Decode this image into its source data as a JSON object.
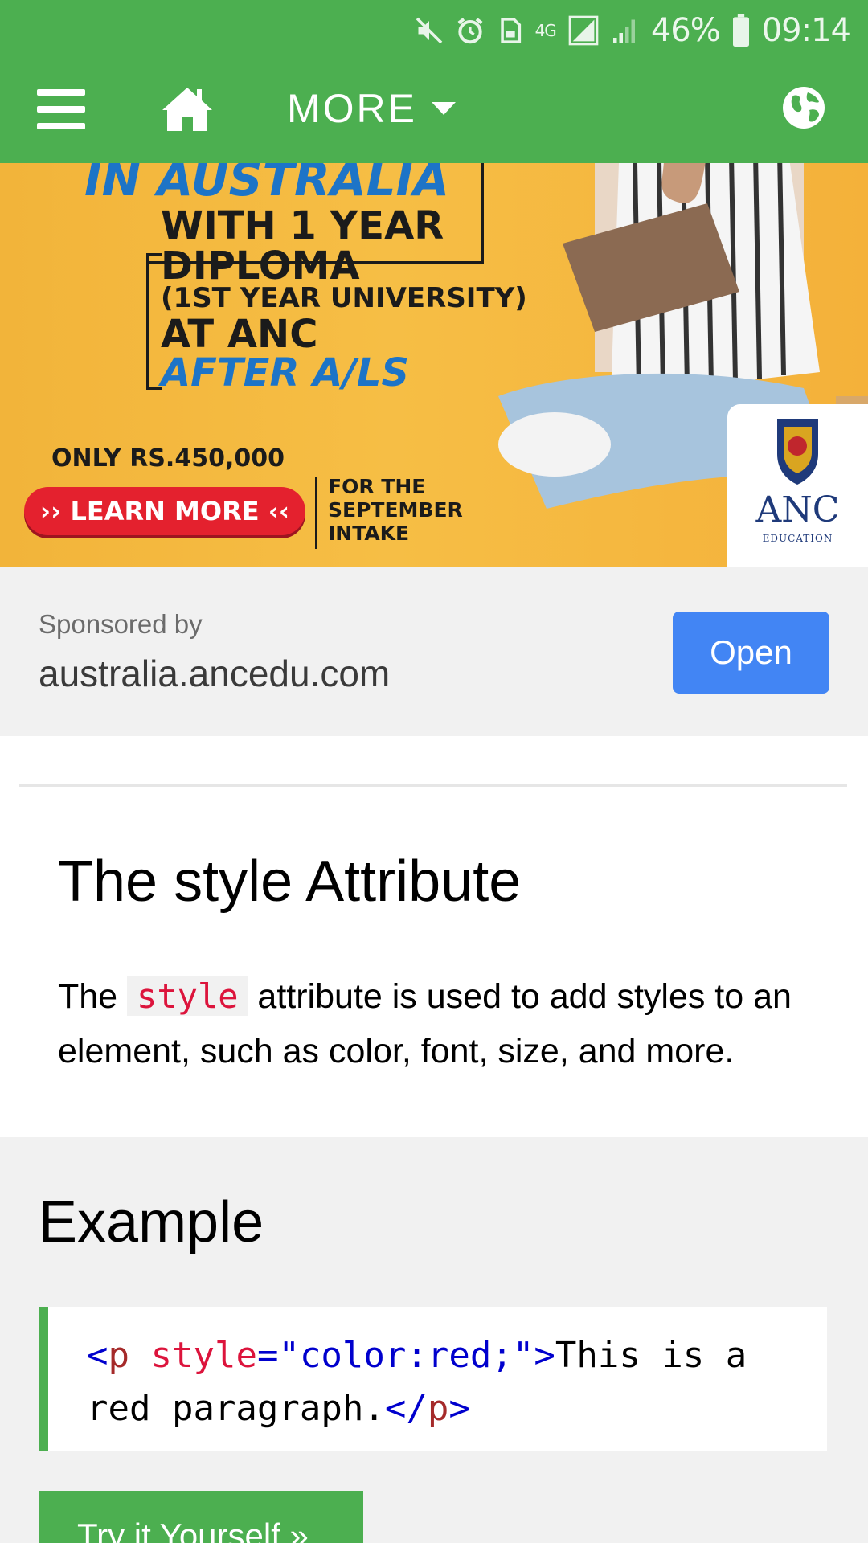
{
  "status_bar": {
    "battery_percent": "46%",
    "time": "09:14",
    "network": "4G",
    "icons": [
      "mute-icon",
      "alarm-icon",
      "sim-card-icon",
      "network-4g-icon",
      "signal-icon",
      "signal-bars-icon",
      "battery-icon"
    ]
  },
  "nav": {
    "more_label": "MORE",
    "icons": [
      "hamburger-menu-icon",
      "home-icon",
      "caret-down-icon",
      "globe-icon"
    ]
  },
  "ad": {
    "line1": "IN AUSTRALIA",
    "line2": "WITH 1 YEAR",
    "line3": "DIPLOMA",
    "line4": "(1ST YEAR UNIVERSITY)",
    "line5": "AT ANC",
    "line6": "AFTER A/LS",
    "price": "ONLY RS.450,000",
    "cta": "›› LEARN MORE ‹‹",
    "intake": [
      "FOR THE",
      "SEPTEMBER",
      "INTAKE"
    ],
    "logo_text": "ANC",
    "logo_sub": "EDUCATION"
  },
  "sponsor": {
    "label": "Sponsored by",
    "domain": "australia.ancedu.com",
    "open_label": "Open"
  },
  "article": {
    "heading": "The style Attribute",
    "para_before": "The ",
    "para_code": "style",
    "para_after": " attribute is used to add styles to an element, such as color, font, size, and more."
  },
  "example": {
    "title": "Example",
    "code": {
      "open_lt": "<",
      "tag": "p",
      "attr": " style",
      "eq": "=",
      "value": "\"color:red;\"",
      "close_gt": ">",
      "text": "This is a red paragraph.",
      "end_lt": "</",
      "end_tag": "p",
      "end_gt": ">"
    },
    "try_label": "Try it Yourself »"
  },
  "colors": {
    "brand_green": "#4caf50",
    "open_blue": "#4285f4",
    "code_red": "#dc143c"
  }
}
